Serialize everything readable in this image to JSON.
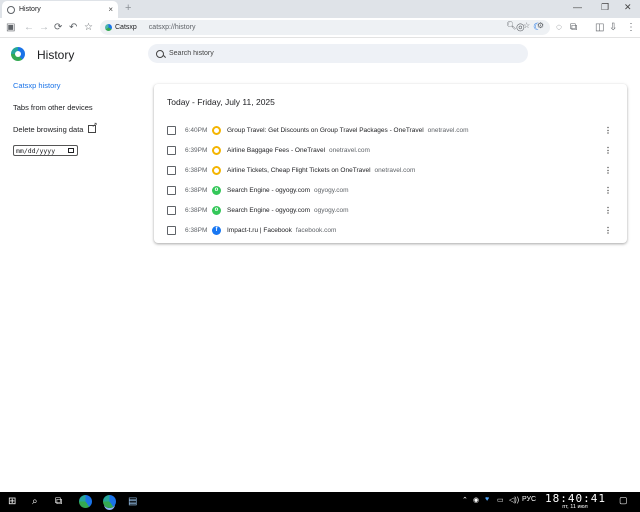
{
  "browser": {
    "tab_title": "History",
    "tab_close": "×",
    "new_tab": "+",
    "site_chip": "Catsxp",
    "url": "catsxp://history",
    "window_controls": [
      "—",
      "❐",
      "✕"
    ]
  },
  "page": {
    "title": "History",
    "search_placeholder": "Search history"
  },
  "sidebar": {
    "items": [
      {
        "label": "Catsxp history",
        "active": true
      },
      {
        "label": "Tabs from other devices",
        "active": false
      },
      {
        "label": "Delete browsing data",
        "active": false
      }
    ],
    "date_input": "mm/dd/yyyy"
  },
  "history": {
    "heading": "Today - Friday, July 11, 2025",
    "entries": [
      {
        "time": "6:40PM",
        "title": "Group Travel: Get Discounts on Group Travel Packages - OneTravel",
        "domain": "onetravel.com",
        "icon": "onetravel-icon"
      },
      {
        "time": "6:39PM",
        "title": "Airline Baggage Fees - OneTravel",
        "domain": "onetravel.com",
        "icon": "onetravel-icon"
      },
      {
        "time": "6:38PM",
        "title": "Airline Tickets, Cheap Flight Tickets on OneTravel",
        "domain": "onetravel.com",
        "icon": "onetravel-icon"
      },
      {
        "time": "6:38PM",
        "title": "Search Engine - ogyogy.com",
        "domain": "ogyogy.com",
        "icon": "ogyogy-icon"
      },
      {
        "time": "6:38PM",
        "title": "Search Engine - ogyogy.com",
        "domain": "ogyogy.com",
        "icon": "ogyogy-icon"
      },
      {
        "time": "6:38PM",
        "title": "Impact-t.ru | Facebook",
        "domain": "facebook.com",
        "icon": "facebook-icon"
      }
    ]
  },
  "taskbar": {
    "lang": "РУС",
    "time": "18:40:41",
    "date": "пт, 11 июл"
  }
}
